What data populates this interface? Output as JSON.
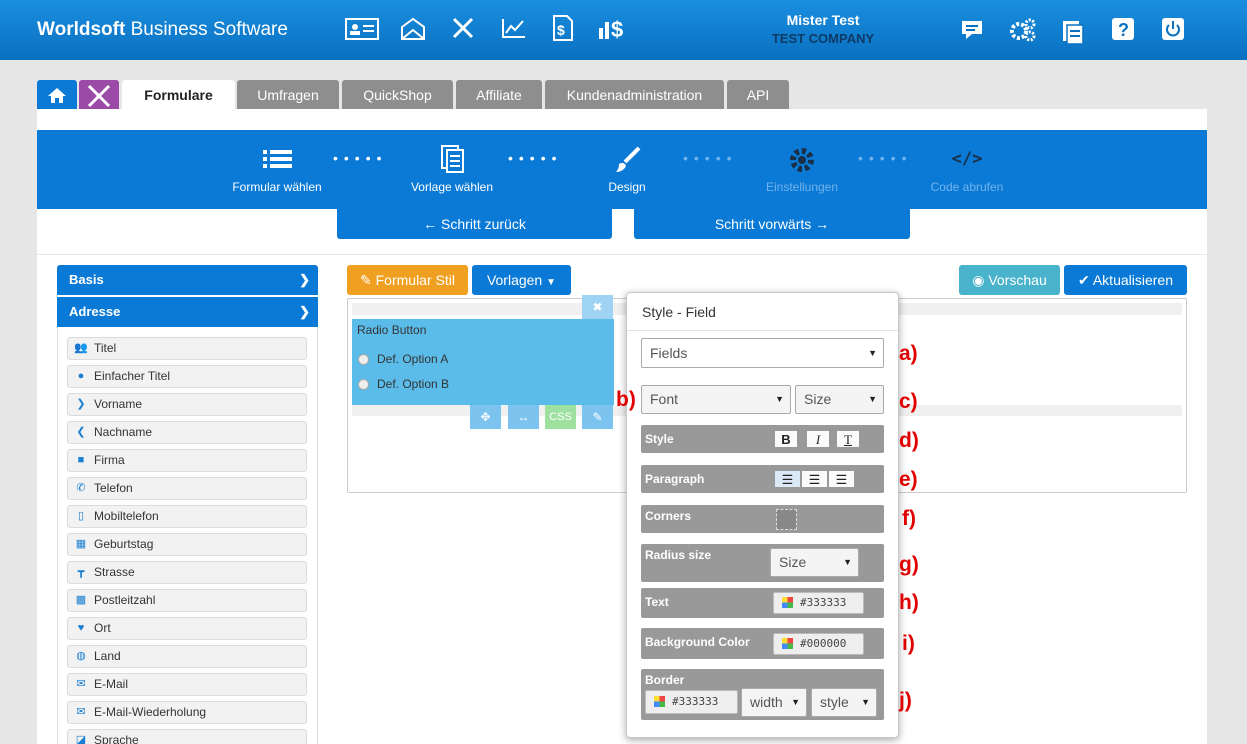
{
  "app": {
    "brand_bold": "Worldsoft",
    "brand_rest": " Business Software"
  },
  "user": {
    "name": "Mister Test",
    "company": "TEST COMPANY"
  },
  "tabs": [
    "Formulare",
    "Umfragen",
    "QuickShop",
    "Affiliate",
    "Kundenadministration",
    "API"
  ],
  "wizard": {
    "steps": [
      "Formular wählen",
      "Vorlage wählen",
      "Design",
      "Einstellungen",
      "Code abrufen"
    ],
    "dots": "•••••",
    "back": "← Schritt zurück",
    "forward": "Schritt vorwärts →"
  },
  "sidebar": {
    "sections": [
      "Basis",
      "Adresse"
    ],
    "items": [
      "Titel",
      "Einfacher Titel",
      "Vorname",
      "Nachname",
      "Firma",
      "Telefon",
      "Mobiltelefon",
      "Geburtstag",
      "Strasse",
      "Postleitzahl",
      "Ort",
      "Land",
      "E-Mail",
      "E-Mail-Wiederholung",
      "Sprache"
    ]
  },
  "toolbar": {
    "style": "Formular Stil",
    "templates": "Vorlagen",
    "preview": "Vorschau",
    "update": "Aktualisieren"
  },
  "field": {
    "label": "Radio Button",
    "options": [
      "Def. Option A",
      "Def. Option B"
    ],
    "css": "CSS"
  },
  "popup": {
    "title": "Style - Field",
    "fields": "Fields",
    "font": "Font",
    "size": "Size",
    "style": "Style",
    "paragraph": "Paragraph",
    "corners": "Corners",
    "radius": "Radius size",
    "radius_size": "Size",
    "text": "Text",
    "text_color": "#333333",
    "bg": "Background Color",
    "bg_color": "#000000",
    "border": "Border",
    "border_color": "#333333",
    "width": "width",
    "style_sel": "style"
  },
  "labels": [
    "a)",
    "b)",
    "c)",
    "d)",
    "e)",
    "f)",
    "g)",
    "h)",
    "i)",
    "j)"
  ],
  "colors": {
    "top": "#0a70c0",
    "wizard": "#0a7ad6",
    "orange": "#f0a020",
    "teal": "#4ab3cc"
  }
}
